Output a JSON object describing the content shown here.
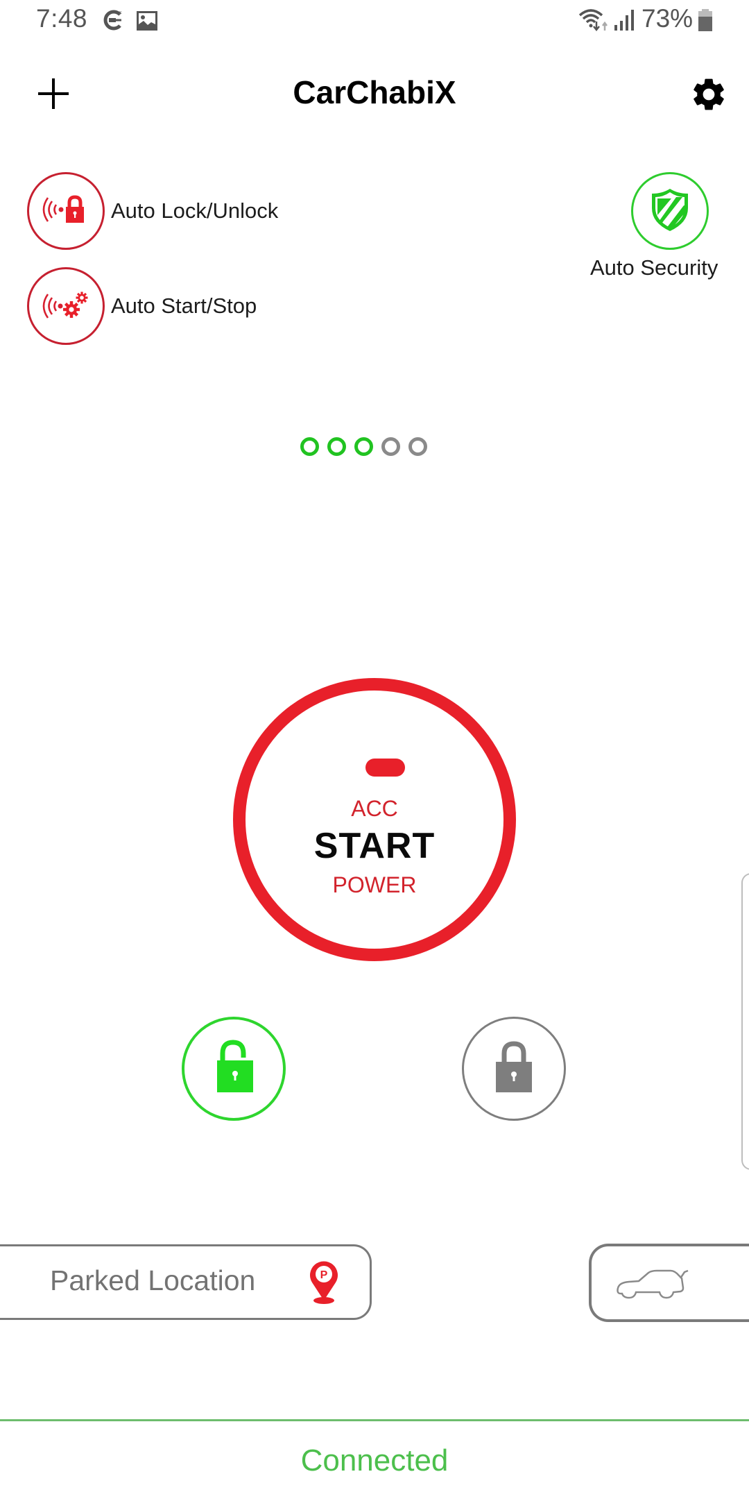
{
  "status_bar": {
    "time": "7:48",
    "left_icons": [
      "sync-app-icon",
      "image-icon"
    ],
    "right_icons": [
      "wifi-icon",
      "signal-icon",
      "battery-icon"
    ],
    "battery_percent": "73%"
  },
  "header": {
    "title": "CarChabiX",
    "add_icon": "plus-icon",
    "settings_icon": "gear-icon"
  },
  "features": [
    {
      "label": "Auto Lock/Unlock",
      "icon": "wireless-lock-icon",
      "state": "off",
      "color": "#c62030"
    },
    {
      "label": "Auto Start/Stop",
      "icon": "wireless-gears-icon",
      "state": "off",
      "color": "#c62030"
    }
  ],
  "security": {
    "label": "Auto Security",
    "icon": "shield-icon",
    "state": "on",
    "color": "#2ecc2e"
  },
  "pager": {
    "total": 5,
    "active": 3,
    "active_color": "#21c321",
    "inactive_color": "#8a8a8a"
  },
  "start_button": {
    "acc_label": "ACC",
    "start_label": "START",
    "power_label": "POWER",
    "ring_color": "#e8202a"
  },
  "locks": {
    "unlock": {
      "icon": "unlock-icon",
      "state": "active",
      "color": "#22dd22"
    },
    "lock": {
      "icon": "lock-icon",
      "state": "inactive",
      "color": "#7e7e7e"
    }
  },
  "bottom": {
    "parked_location_label": "Parked Location",
    "parked_icon": "parking-pin-icon",
    "trunk_icon": "car-trunk-icon"
  },
  "footer": {
    "status": "Connected",
    "color": "#4cbf4c"
  }
}
